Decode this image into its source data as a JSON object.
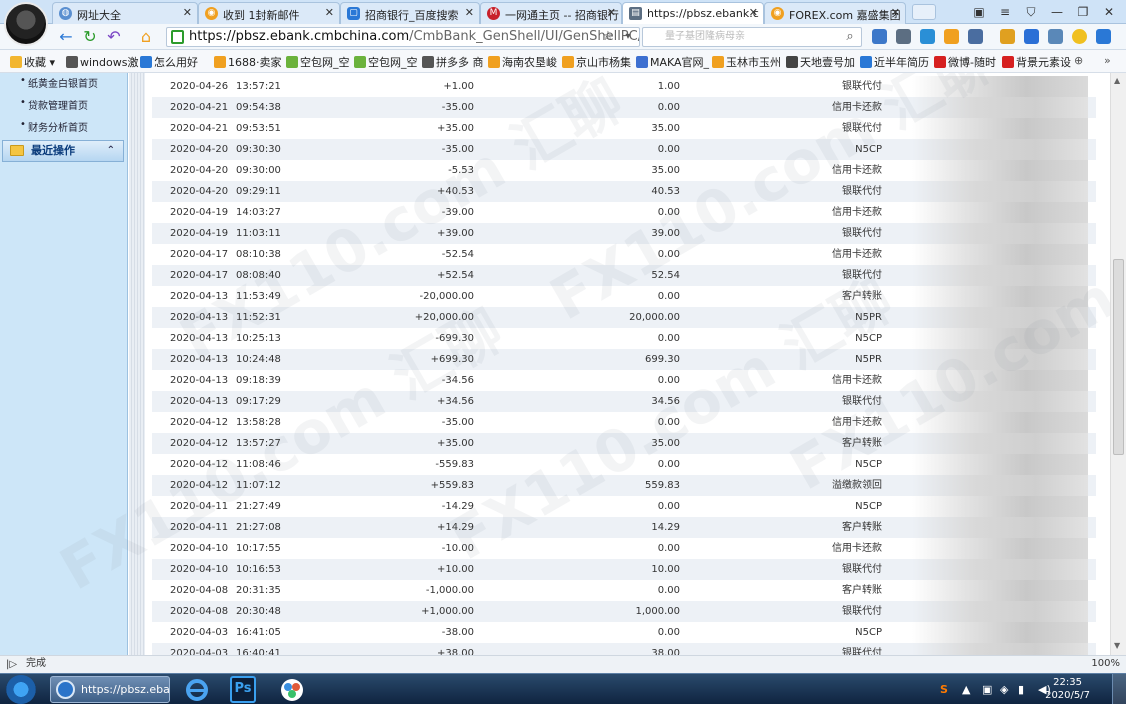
{
  "browser": {
    "tabs": [
      {
        "title": "网址大全",
        "color": "#5a8fd0"
      },
      {
        "title": "收到 1封新邮件",
        "color": "#f0a020"
      },
      {
        "title": "招商银行_百度搜索",
        "color": "#2a78d6"
      },
      {
        "title": "一网通主页 -- 招商银行",
        "color": "#c8202a"
      },
      {
        "title": "https://pbsz.ebank.c",
        "color": "#5c6e82"
      },
      {
        "title": "FOREX.com 嘉盛集团",
        "color": "#f0a020"
      }
    ],
    "address": "https://pbsz.ebank.cmbchina.com/CmbBank_GenShell/UI/GenShellPC/Login/(",
    "address_host": "https://pbsz.ebank.cmbchina.com",
    "address_path": "/CmbBank_GenShell/UI/GenShellPC/Login/(",
    "search_placeholder": "量子基团隆病母亲",
    "bookmarks": [
      {
        "label": "收藏",
        "color": "#f2b630"
      },
      {
        "label": "windows激",
        "color": "#555555"
      },
      {
        "label": "怎么用好",
        "color": "#2a78d6"
      },
      {
        "label": "1688·卖家",
        "color": "#f0a020"
      },
      {
        "label": "空包网_空",
        "color": "#6bb23c"
      },
      {
        "label": "空包网_空",
        "color": "#6bb23c"
      },
      {
        "label": "拼多多 商",
        "color": "#555555"
      },
      {
        "label": "海南农垦峻",
        "color": "#f0a020"
      },
      {
        "label": "京山市杨集",
        "color": "#f0a020"
      },
      {
        "label": "MAKA官网_",
        "color": "#3d6fd0"
      },
      {
        "label": "玉林市玉州",
        "color": "#f0a020"
      },
      {
        "label": "天地壹号加",
        "color": "#444444"
      },
      {
        "label": "近半年简历",
        "color": "#2a78d6"
      },
      {
        "label": "微博-随时",
        "color": "#d62020"
      },
      {
        "label": "背景元素设",
        "color": "#d62020"
      }
    ]
  },
  "sidebar": {
    "links": [
      "纸黄金白银首页",
      "贷款管理首页",
      "财务分析首页"
    ],
    "section_title": "最近操作"
  },
  "transactions": [
    {
      "date": "2020-04-26",
      "time": "13:57:21",
      "amount": "+1.00",
      "balance": "1.00",
      "type": "银联代付"
    },
    {
      "date": "2020-04-21",
      "time": "09:54:38",
      "amount": "-35.00",
      "balance": "0.00",
      "type": "信用卡还款"
    },
    {
      "date": "2020-04-21",
      "time": "09:53:51",
      "amount": "+35.00",
      "balance": "35.00",
      "type": "银联代付"
    },
    {
      "date": "2020-04-20",
      "time": "09:30:30",
      "amount": "-35.00",
      "balance": "0.00",
      "type": "N5CP"
    },
    {
      "date": "2020-04-20",
      "time": "09:30:00",
      "amount": "-5.53",
      "balance": "35.00",
      "type": "信用卡还款"
    },
    {
      "date": "2020-04-20",
      "time": "09:29:11",
      "amount": "+40.53",
      "balance": "40.53",
      "type": "银联代付"
    },
    {
      "date": "2020-04-19",
      "time": "14:03:27",
      "amount": "-39.00",
      "balance": "0.00",
      "type": "信用卡还款"
    },
    {
      "date": "2020-04-19",
      "time": "11:03:11",
      "amount": "+39.00",
      "balance": "39.00",
      "type": "银联代付"
    },
    {
      "date": "2020-04-17",
      "time": "08:10:38",
      "amount": "-52.54",
      "balance": "0.00",
      "type": "信用卡还款"
    },
    {
      "date": "2020-04-17",
      "time": "08:08:40",
      "amount": "+52.54",
      "balance": "52.54",
      "type": "银联代付"
    },
    {
      "date": "2020-04-13",
      "time": "11:53:49",
      "amount": "-20,000.00",
      "balance": "0.00",
      "type": "客户转账"
    },
    {
      "date": "2020-04-13",
      "time": "11:52:31",
      "amount": "+20,000.00",
      "balance": "20,000.00",
      "type": "N5PR"
    },
    {
      "date": "2020-04-13",
      "time": "10:25:13",
      "amount": "-699.30",
      "balance": "0.00",
      "type": "N5CP"
    },
    {
      "date": "2020-04-13",
      "time": "10:24:48",
      "amount": "+699.30",
      "balance": "699.30",
      "type": "N5PR"
    },
    {
      "date": "2020-04-13",
      "time": "09:18:39",
      "amount": "-34.56",
      "balance": "0.00",
      "type": "信用卡还款"
    },
    {
      "date": "2020-04-13",
      "time": "09:17:29",
      "amount": "+34.56",
      "balance": "34.56",
      "type": "银联代付"
    },
    {
      "date": "2020-04-12",
      "time": "13:58:28",
      "amount": "-35.00",
      "balance": "0.00",
      "type": "信用卡还款"
    },
    {
      "date": "2020-04-12",
      "time": "13:57:27",
      "amount": "+35.00",
      "balance": "35.00",
      "type": "客户转账"
    },
    {
      "date": "2020-04-12",
      "time": "11:08:46",
      "amount": "-559.83",
      "balance": "0.00",
      "type": "N5CP"
    },
    {
      "date": "2020-04-12",
      "time": "11:07:12",
      "amount": "+559.83",
      "balance": "559.83",
      "type": "溢缴款领回"
    },
    {
      "date": "2020-04-11",
      "time": "21:27:49",
      "amount": "-14.29",
      "balance": "0.00",
      "type": "N5CP"
    },
    {
      "date": "2020-04-11",
      "time": "21:27:08",
      "amount": "+14.29",
      "balance": "14.29",
      "type": "客户转账"
    },
    {
      "date": "2020-04-10",
      "time": "10:17:55",
      "amount": "-10.00",
      "balance": "0.00",
      "type": "信用卡还款"
    },
    {
      "date": "2020-04-10",
      "time": "10:16:53",
      "amount": "+10.00",
      "balance": "10.00",
      "type": "银联代付"
    },
    {
      "date": "2020-04-08",
      "time": "20:31:35",
      "amount": "-1,000.00",
      "balance": "0.00",
      "type": "客户转账"
    },
    {
      "date": "2020-04-08",
      "time": "20:30:48",
      "amount": "+1,000.00",
      "balance": "1,000.00",
      "type": "银联代付"
    },
    {
      "date": "2020-04-03",
      "time": "16:41:05",
      "amount": "-38.00",
      "balance": "0.00",
      "type": "N5CP"
    },
    {
      "date": "2020-04-03",
      "time": "16:40:41",
      "amount": "+38.00",
      "balance": "38.00",
      "type": "银联代付"
    }
  ],
  "statusbar": {
    "status": "完成",
    "zoom": "100%"
  },
  "taskbar": {
    "browser_task": "https://pbsz.eba...",
    "time": "22:35",
    "date": "2020/5/7"
  },
  "watermark": "FX110.com 汇聊"
}
